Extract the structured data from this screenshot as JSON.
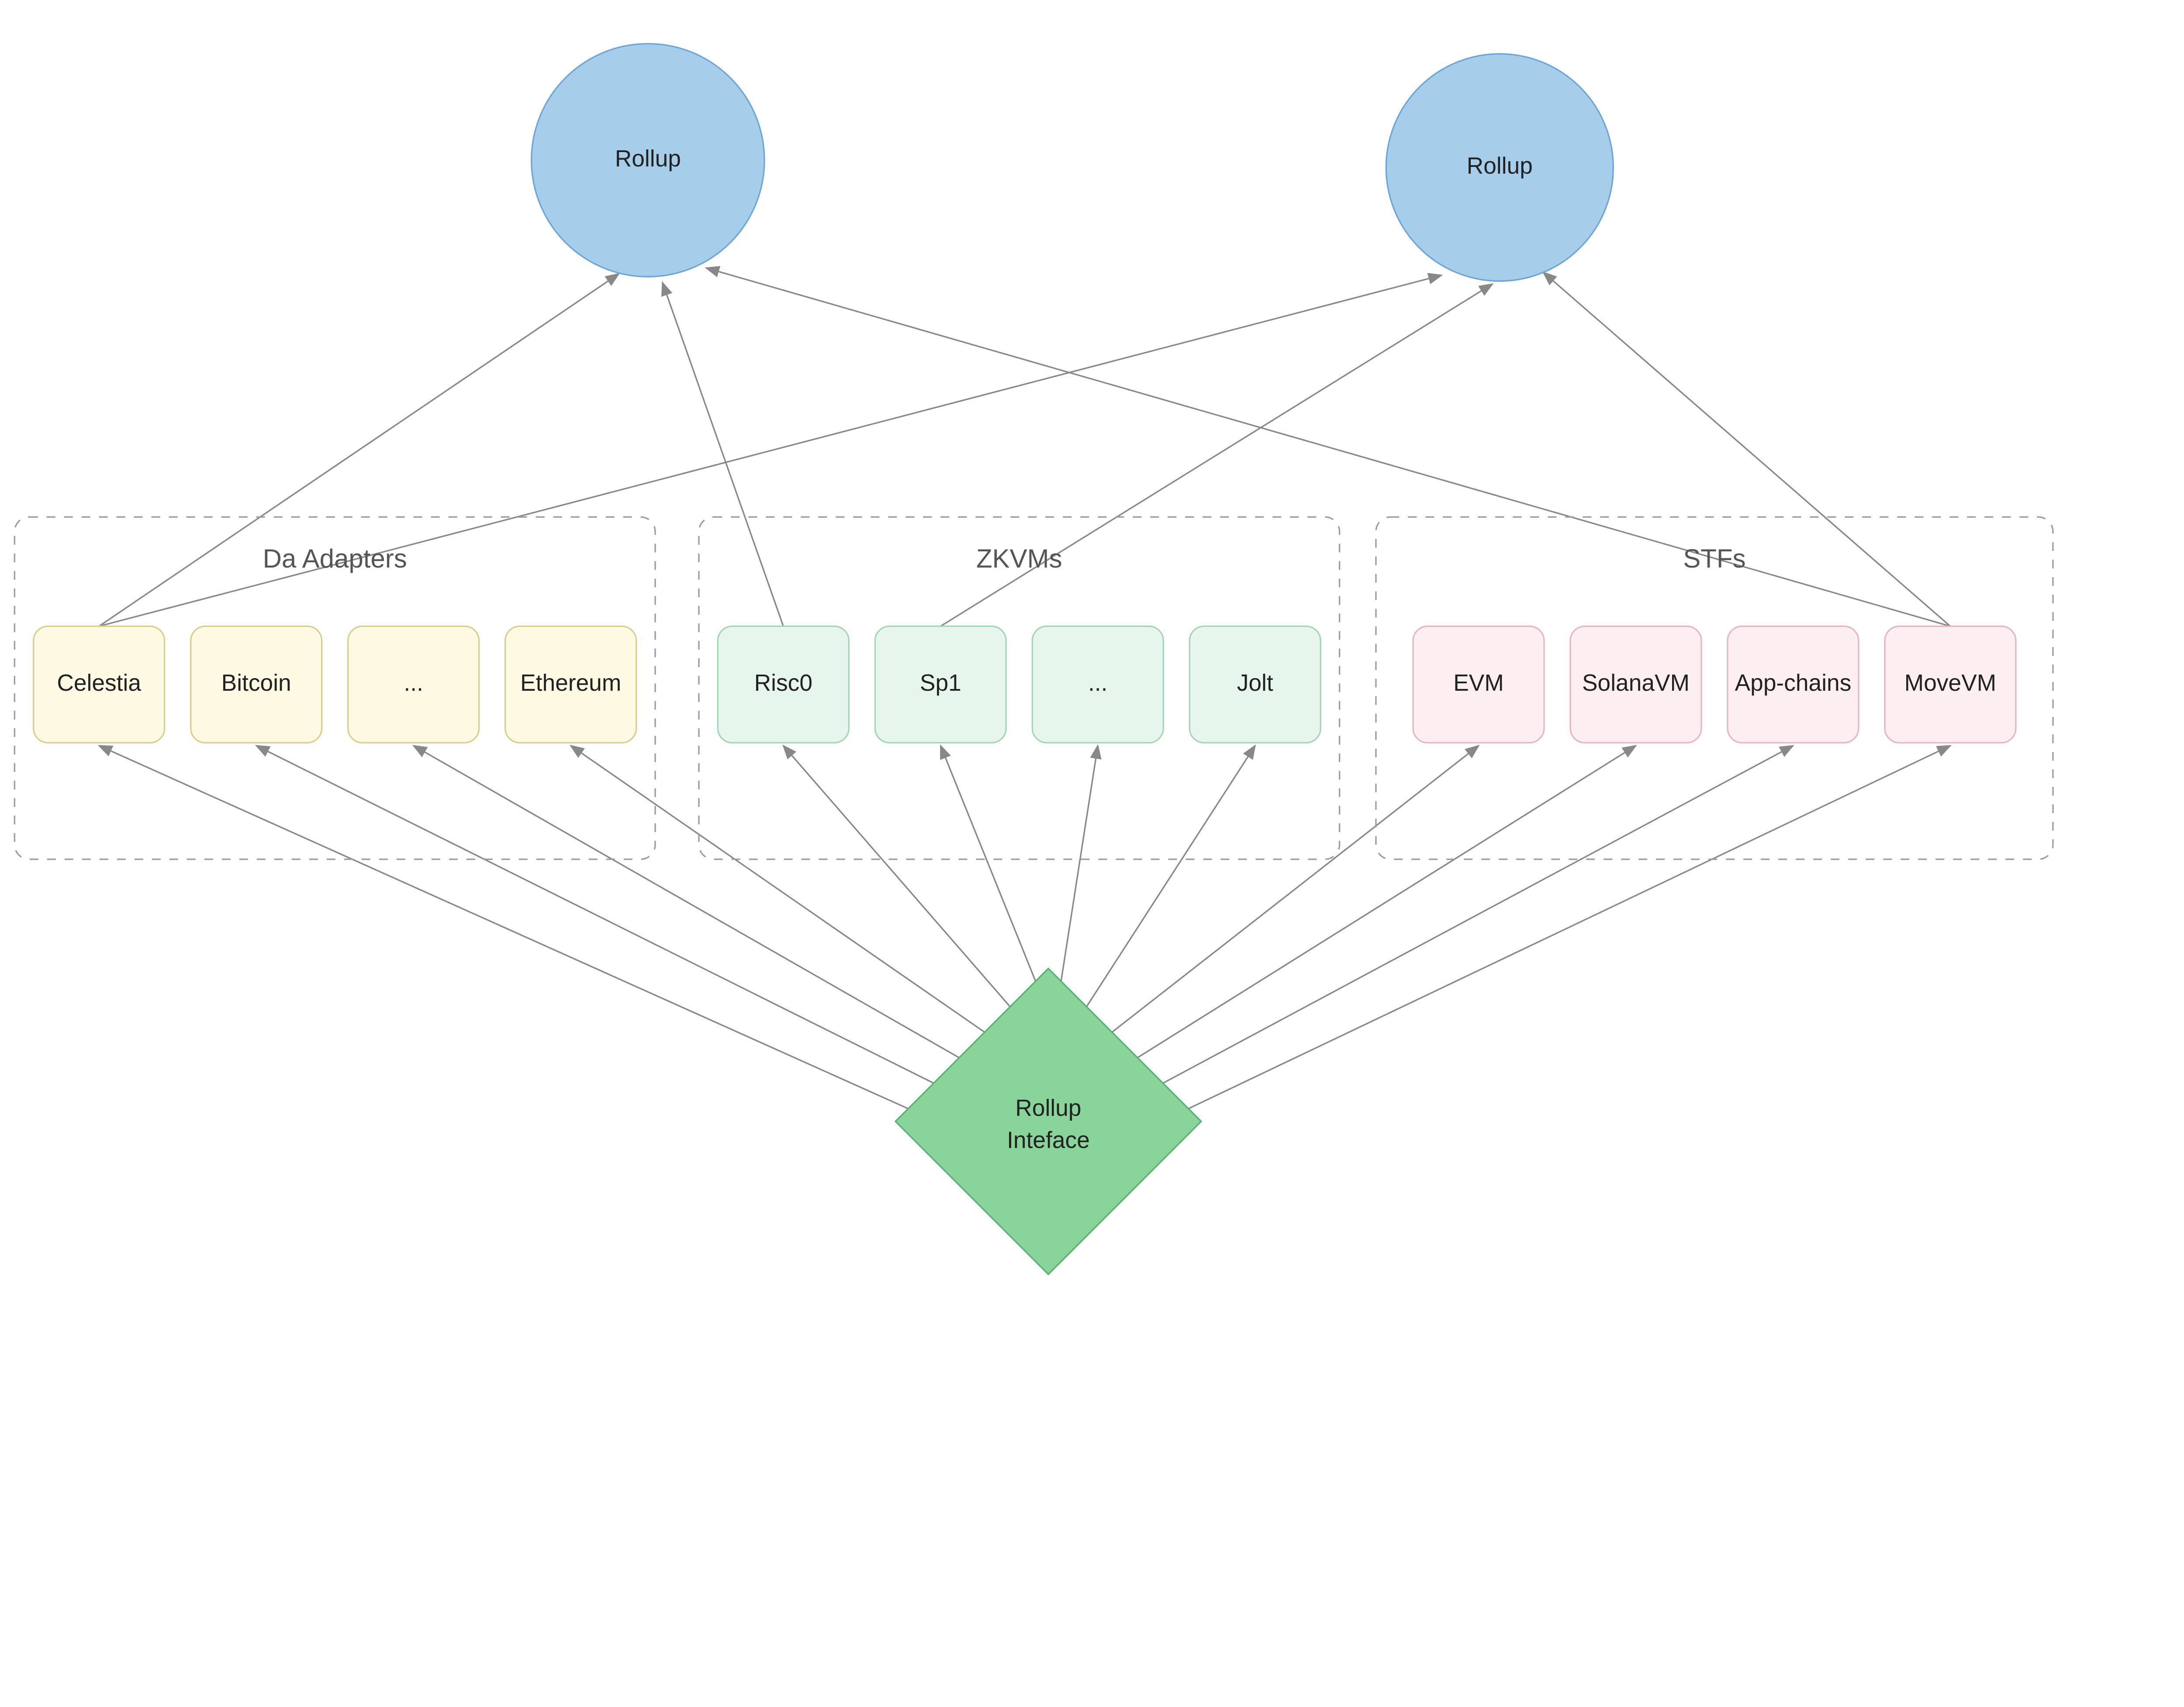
{
  "rollups": {
    "left": "Rollup",
    "right": "Rollup"
  },
  "interface": {
    "line1": "Rollup",
    "line2": "Inteface"
  },
  "groups": {
    "da": {
      "title": "Da Adapters",
      "items": [
        "Celestia",
        "Bitcoin",
        "...",
        "Ethereum"
      ],
      "fill": "#fdf9e3",
      "stroke": "#d9cf8f"
    },
    "zkvms": {
      "title": "ZKVMs",
      "items": [
        "Risc0",
        "Sp1",
        "...",
        "Jolt"
      ],
      "fill": "#e6f6ec",
      "stroke": "#a7d6b7"
    },
    "stfs": {
      "title": "STFs",
      "items": [
        "EVM",
        "SolanaVM",
        "App-chains",
        "MoveVM"
      ],
      "fill": "#fceef1",
      "stroke": "#e4b8c4"
    }
  },
  "colors": {
    "rollupFill": "#a6ceea",
    "rollupStroke": "#6fa6d6",
    "interfaceFill": "#89d49a",
    "interfaceStroke": "#5bb172"
  }
}
